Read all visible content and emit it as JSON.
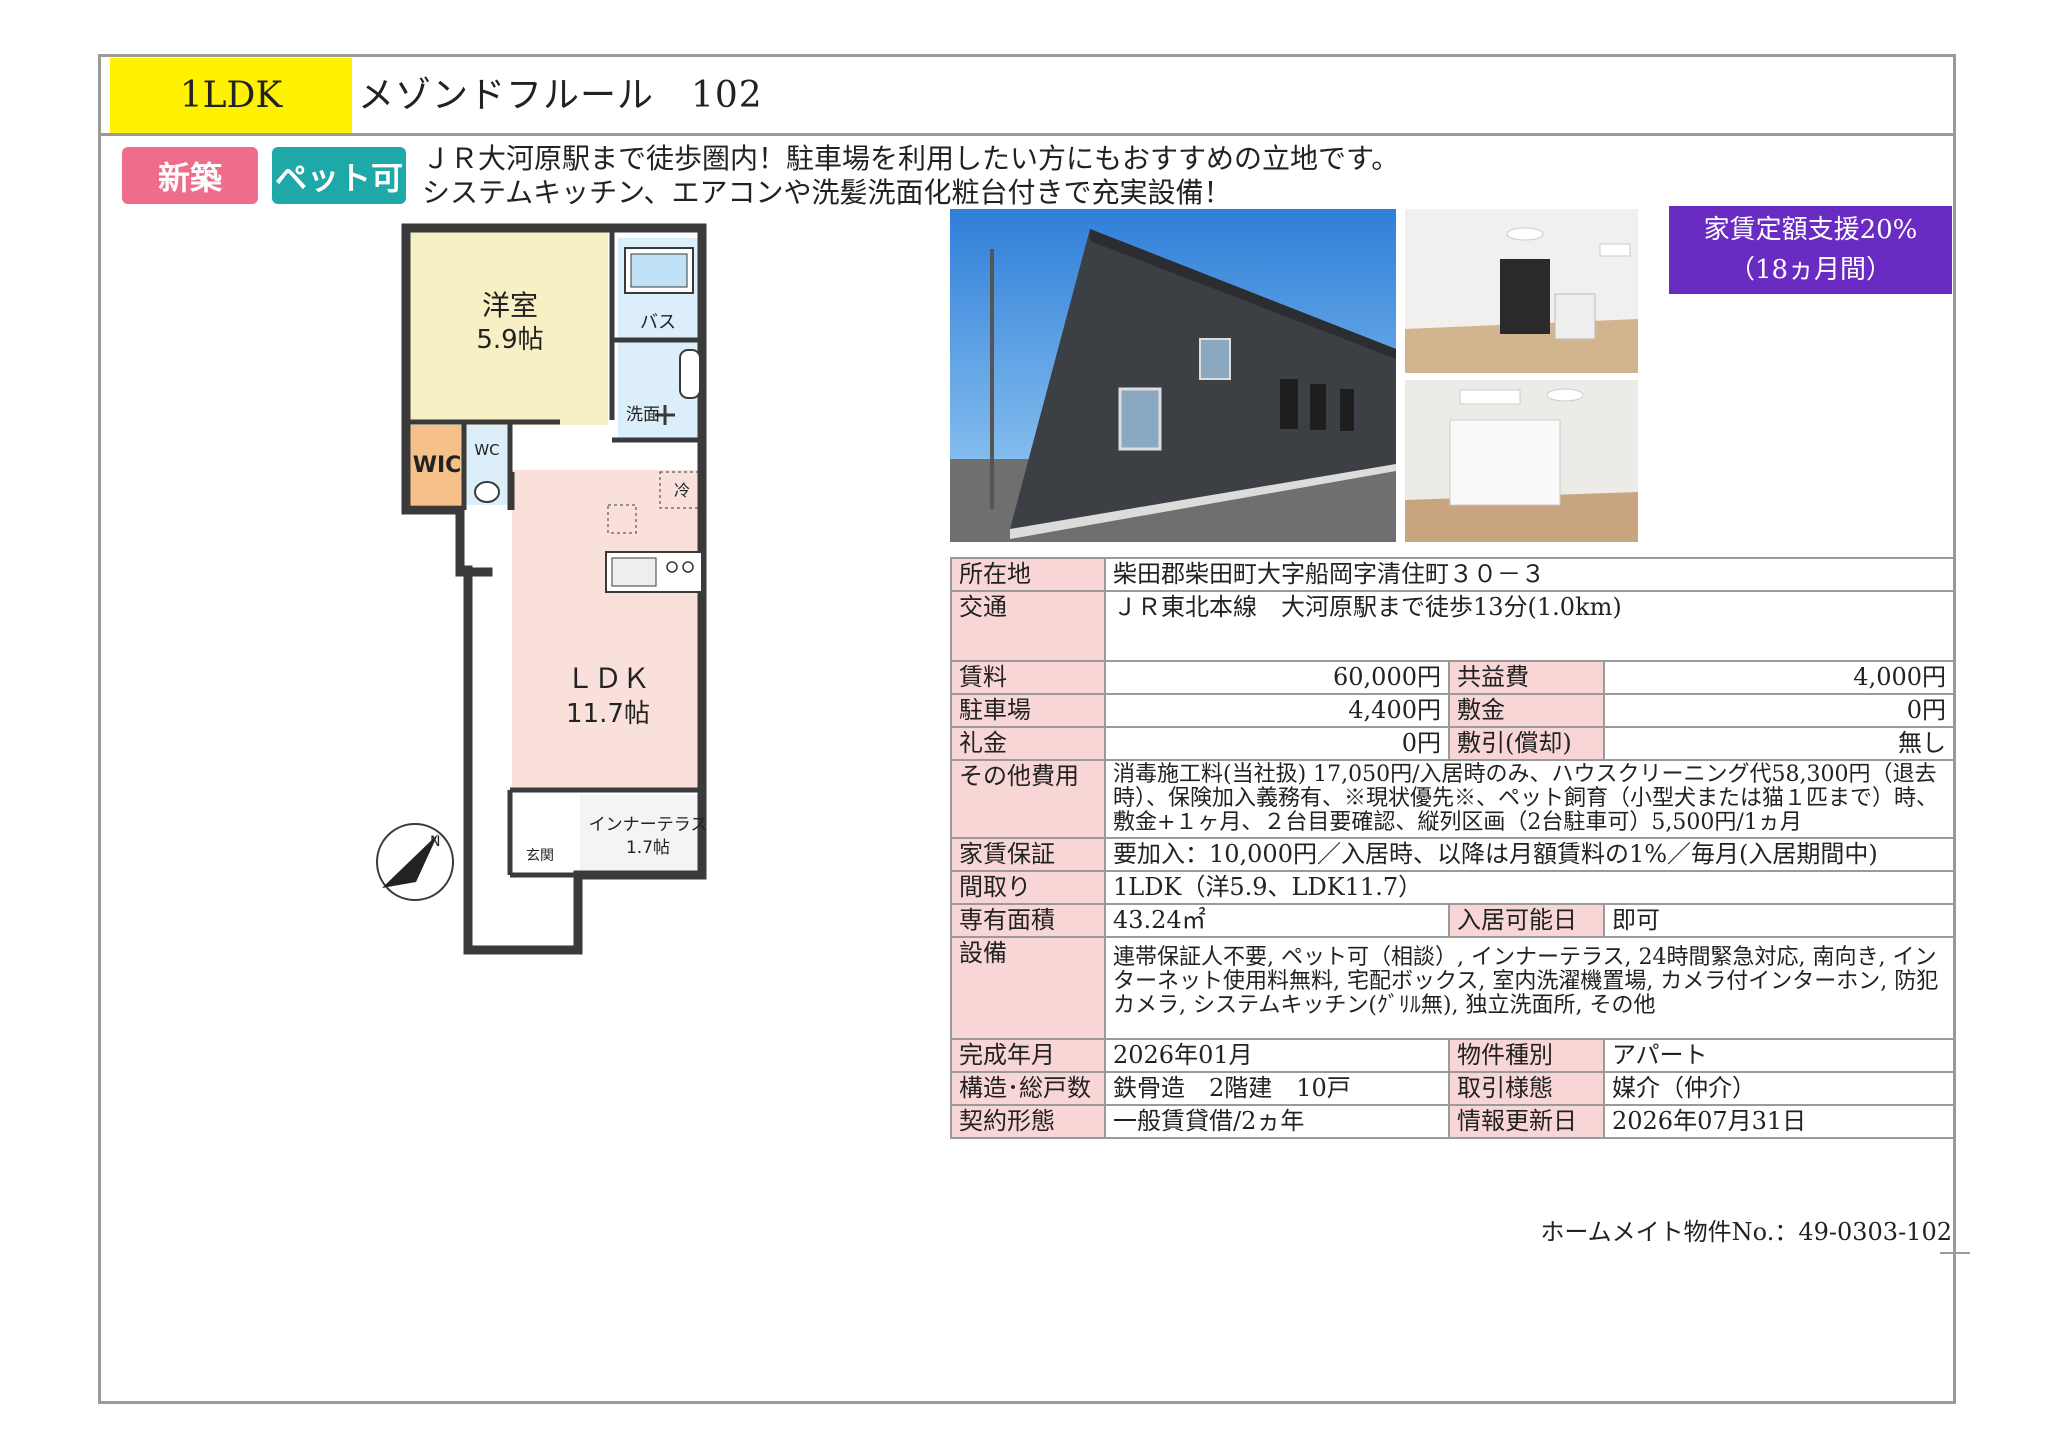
{
  "header": {
    "type_label": "1LDK",
    "property_name": "メゾンドフルール　102"
  },
  "badges": {
    "new": "新築",
    "pet": "ペット可"
  },
  "catchcopy": {
    "line1": "ＪＲ大河原駅まで徒歩圏内！駐車場を利用したい方にもおすすめの立地です。",
    "line2": "システムキッチン、エアコンや洗髪洗面化粧台付きで充実設備！"
  },
  "support": {
    "line1": "家賃定額支援20%",
    "line2": "（18ヵ月間）"
  },
  "floorplan": {
    "room1_name": "洋室",
    "room1_size": "5.9帖",
    "bath": "バス",
    "washroom": "洗面",
    "wic": "WIC",
    "wc": "WC",
    "fridge": "冷",
    "ldk_name": "ＬＤＫ",
    "ldk_size": "11.7帖",
    "terrace_name": "インナーテラス",
    "terrace_size": "1.7帖",
    "entrance": "玄関",
    "compass_label": "N"
  },
  "info": {
    "address_label": "所在地",
    "address": "柴田郡柴田町大字船岡字清住町３０－３",
    "access_label": "交通",
    "access": "ＪＲ東北本線　大河原駅まで徒歩13分(1.0km)",
    "rent_label": "賃料",
    "rent": "60,000円",
    "common_label": "共益費",
    "common": "4,000円",
    "parking_label": "駐車場",
    "parking": "4,400円",
    "deposit_label": "敷金",
    "deposit": "0円",
    "key_money_label": "礼金",
    "key_money": "0円",
    "deduction_label": "敷引(償却)",
    "deduction": "無し",
    "other_label": "その他費用",
    "other": "消毒施工料(当社扱) 17,050円/入居時のみ、ハウスクリーニング代58,300円（退去時）、保険加入義務有、※現状優先※、ペット飼育（小型犬または猫１匹まで）時、敷金+１ヶ月、２台目要確認、縦列区画（2台駐車可）5,500円/1ヵ月",
    "guarantee_label": "家賃保証",
    "guarantee": "要加入：10,000円／入居時、以降は月額賃料の1%／毎月(入居期間中)",
    "layout_label": "間取り",
    "layout": "1LDK（洋5.9、LDK11.7）",
    "area_label": "専有面積",
    "area": "43.24㎡",
    "movein_label": "入居可能日",
    "movein": "即可",
    "equipment_label": "設備",
    "equipment": "連帯保証人不要, ペット可（相談）, インナーテラス, 24時間緊急対応, 南向き, インターネット使用料無料, 宅配ボックス, 室内洗濯機置場, カメラ付インターホン, 防犯カメラ, システムキッチン(ｸﾞﾘﾙ無), 独立洗面所, その他",
    "built_label": "完成年月",
    "built": "2026年01月",
    "kind_label": "物件種別",
    "kind": "アパート",
    "structure_label": "構造･総戸数",
    "structure": "鉄骨造　2階建　10戸",
    "deal_label": "取引様態",
    "deal": "媒介（仲介）",
    "contract_label": "契約形態",
    "contract": "一般賃貸借/2ヵ年",
    "updated_label": "情報更新日",
    "updated": "2026年07月31日"
  },
  "footer": {
    "property_no": "ホームメイト物件No.：49-0303-102"
  },
  "colors": {
    "type_bg": "#fff200",
    "badge_new": "#ee6d8a",
    "badge_pet": "#1ea8a8",
    "support_bg": "#6a2bc2",
    "label_bg": "#f8d6d6",
    "room_yellow": "#f7f0c4",
    "room_pink": "#f9e0da",
    "room_blue": "#dceefa",
    "wic_orange": "#f5c08a"
  }
}
